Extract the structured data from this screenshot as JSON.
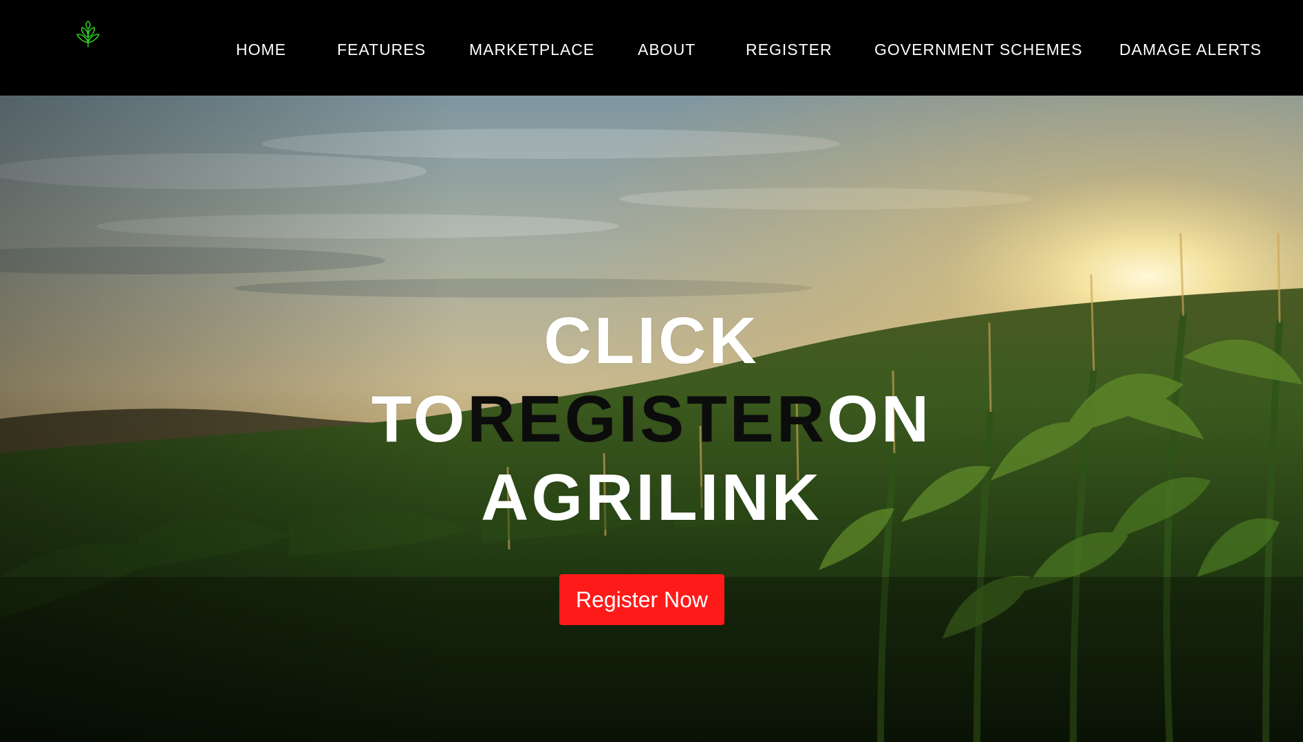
{
  "header": {
    "logo_icon": "sprout-icon",
    "logo_color": "#2ecc1f",
    "nav": {
      "home": "HOME",
      "features": "FEATURES",
      "marketplace": "MARKETPLACE",
      "about": "ABOUT",
      "register": "REGISTER",
      "schemes": "GOVERNMENT SCHEMES",
      "alerts": "DAMAGE ALERTS"
    }
  },
  "hero": {
    "background": "cornfield-sunset-photo",
    "title": {
      "line1": "CLICK",
      "line2_a": "TO",
      "line2_b": "REGISTER",
      "line2_c": "ON",
      "line3": "AGRILINK"
    },
    "button_label": "Register Now",
    "button_color": "#ff1a1a"
  }
}
